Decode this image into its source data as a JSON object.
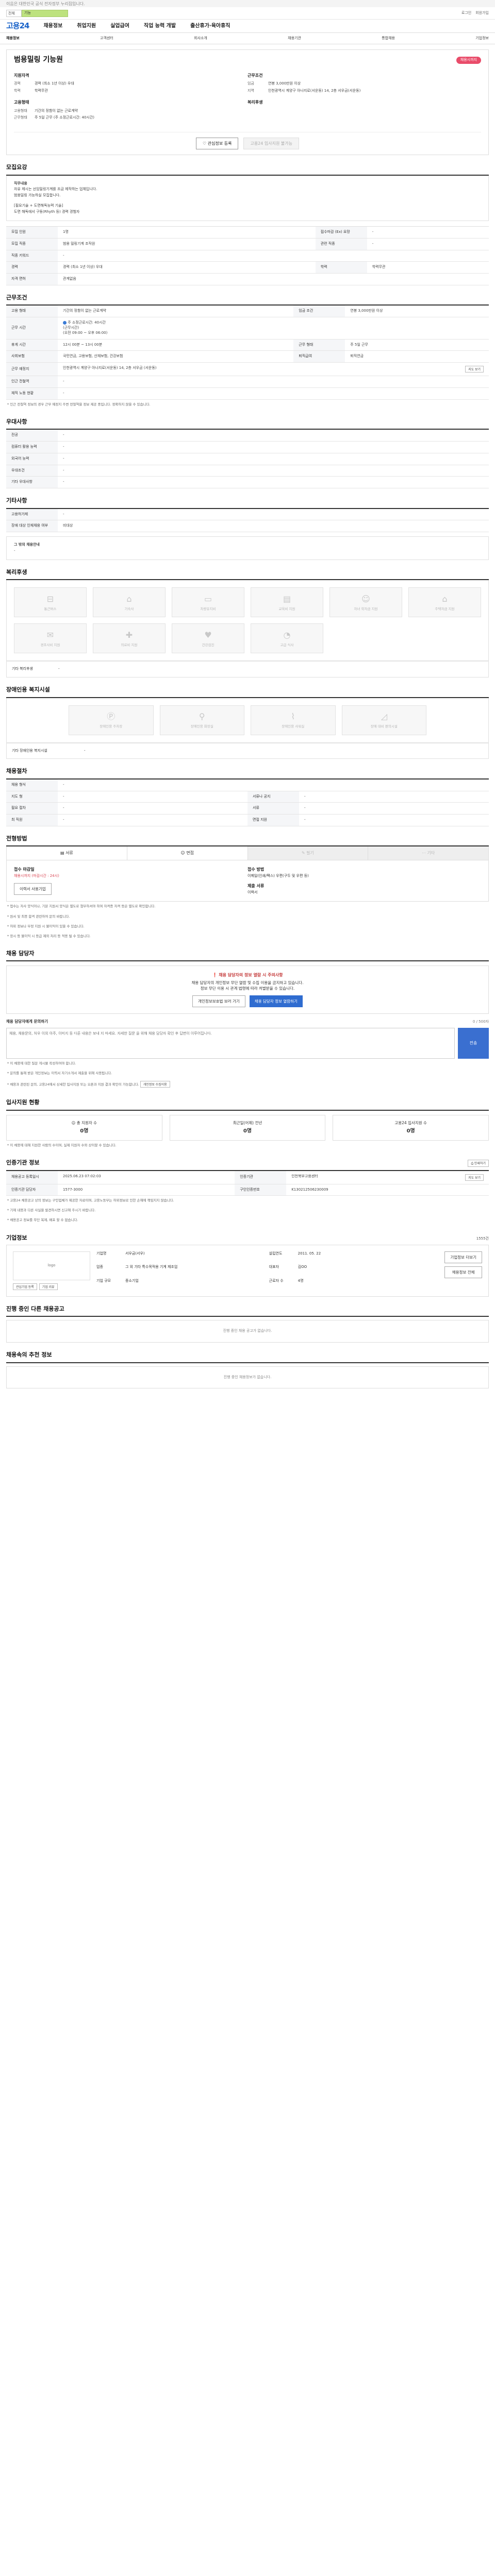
{
  "top_notice": "이음은 대한민국 공식 전자정부 누리집입니다.",
  "search": {
    "select": "전체",
    "value": "기능"
  },
  "util_links": [
    "로그인",
    "회원가입"
  ],
  "logo": "고용24",
  "gnb": [
    "채용정보",
    "취업지원",
    "실업급여",
    "직업 능력 개발",
    "출산휴가·육아휴직"
  ],
  "subnav": [
    "채용정보",
    "고객센터",
    "회사소개",
    "채용기관",
    "통합채용",
    "기업정보"
  ],
  "job": {
    "title": "범용밀링 기능원",
    "status_badge": "채용시까지",
    "left_h": "지원자격",
    "left": [
      [
        "경력",
        "경력 (최소 1년 이상) 우대"
      ],
      [
        "학력",
        "학력무관"
      ]
    ],
    "cond_h": "고용형태",
    "cond": [
      [
        "고용형태",
        "기간의 정함이 없는 근로계약"
      ],
      [
        "근무형태",
        "주 5일 근무 (주 소정근로시간: 40시간)"
      ]
    ],
    "right_h": "근무조건",
    "right": [
      [
        "임금",
        "연봉 3,000만원 이상"
      ],
      [
        "지역",
        "인천광역시 계양구 아나지로(서운동) 14, 2층 서우금(서운동)"
      ]
    ],
    "welfare_h": "복리후생",
    "btn_save": "관심정보 등록",
    "btn_apply": "고용24 입사지원 불가능"
  },
  "recruit": {
    "title": "모집요강",
    "body": [
      "직무내용",
      "자유 제시는 선임밀링기계를 조금 제작하는 업체입니다.",
      "범용밀링 가능하실 모집합니다.",
      "",
      "[필요기술 + 도면해독능력 기술]",
      "도면 해독에서 구동(Rhyth 등) 경력 경험자"
    ],
    "rows": [
      [
        "모집 인원",
        "1명",
        "접수마감 (Ex) 요망",
        "-"
      ],
      [
        "모집 직종",
        "범용 밀링기계 조작원",
        "관련 직종",
        "-"
      ],
      [
        "직종 키워드",
        "-",
        "",
        ""
      ],
      [
        "경력",
        "경력 (최소 1년 이상) 우대",
        "학력",
        "학력무관"
      ],
      [
        "자격 면허",
        "관계없음",
        "",
        ""
      ]
    ]
  },
  "work": {
    "title": "근무조건",
    "rows": [
      [
        "고용 형태",
        "기간의 정함이 없는 근로계약",
        "임금 조건",
        "연봉 3,000만원 이상"
      ]
    ],
    "hours_k": "근무 시간",
    "hours": [
      "주 소정근로시간: 40시간",
      "(근무시간)",
      "(오전 09:00 ~ 오후 06:00)",
      "(오전 09:00 ~ 오후 06:00)"
    ],
    "rows2": [
      [
        "휴게 시간",
        "12시 00분 ~ 13시 00분",
        "근무 형태",
        "주 5일 근무"
      ],
      [
        "사회보험",
        "국민연금, 고용보험, 산재보험, 건강보험",
        "퇴직급여",
        "퇴직연금"
      ]
    ],
    "addr_k": "근무 예정지",
    "addr_v": "인천광역시 계양구 아나지로(서운동) 14, 2층 서우금 (서운동)",
    "map_btn": "지도 보기",
    "rows3": [
      [
        "인근 전철역",
        "-"
      ],
      [
        "재직 노동 현황",
        "-"
      ]
    ],
    "note": "* 인근 전철역 정보의 경우 근무 예정지 주변 전철역을 정보 제공 중입니다. 정확하지 않을 수 있습니다."
  },
  "prefer": {
    "title": "우대사항",
    "rows": [
      [
        "전공",
        "-"
      ],
      [
        "컴퓨터 활용 능력",
        "-"
      ],
      [
        "외국어 능력",
        "-"
      ],
      [
        "우대조건",
        "-"
      ],
      [
        "기타 우대사항",
        "-"
      ]
    ]
  },
  "etc": {
    "title": "기타사항",
    "rows": [
      [
        "고용허가제",
        "-"
      ],
      [
        "장애 대상 인재채용 여부",
        "비대상"
      ]
    ],
    "extra": "그 밖의 채용안내",
    "extra_v": "-"
  },
  "welfare": {
    "title": "복리후생",
    "tiles": [
      "통근버스",
      "기숙사",
      "차량유지비",
      "교육비 지원",
      "자녀 학자금 지원",
      "주택자금 지원",
      "경조사비 지원",
      "의료비 지원",
      "건강검진",
      "고급 식사"
    ],
    "extra_k": "기타 복리후생",
    "extra_v": "-"
  },
  "barrier": {
    "title": "장애인용 복지시설",
    "tiles": [
      "장애인용 주차장",
      "장애인용 화장실",
      "장애인용 샤워실",
      "장애 대비 편의시설"
    ],
    "extra_k": "기타 장애인용 복지시설",
    "extra_v": "-"
  },
  "process": {
    "title": "채용절차",
    "rows": [
      [
        "채용 형식",
        "-",
        "",
        ""
      ],
      [
        "지도 형",
        "-",
        "서류나 공지",
        "-"
      ],
      [
        "필요 절차",
        "-",
        "서류",
        "-"
      ],
      [
        "최 직원",
        "-",
        "면접 지원",
        "-"
      ]
    ]
  },
  "apply": {
    "title": "전형방법",
    "tabs": [
      "서류",
      "면접",
      "필기",
      "기타"
    ],
    "left_h": "접수 마감일",
    "left_v": "채용시까지 (마감시간 : 24시)",
    "left_btn": "이력서 사용기업",
    "right_h": "접수 방법",
    "right_v": "이메일(인쇄/팩스) 우편(구두 및 우편 등)",
    "right_h2": "제출 서류",
    "right_v2": "이력서",
    "notes": [
      "* 접수는 자사 양식이나, 기본 지원서 양식은 별도로 첨부하셔야 하며 자격증 자격 등은 별도로 확인합니다.",
      "* 원서 및 최종 합격 관련하여 문의 바랍니다.",
      "* 허위 정보나 부정 지원 시 불이익이 있을 수 있습니다.",
      "* 장시 등 불이익 시 등급 제외 처리 등 적용 될 수 있습니다."
    ]
  },
  "manager": {
    "title": "채용 담당자",
    "alert_head": "채용 담당자의 정보 열람 시 주의사항",
    "alert_body": "채용 담당자의 개인정보 무단 열람 및 수집 이용을 금지하고 있습니다.",
    "alert_body2": "정보 무단 이용 시 관계 법령에 따라 처벌받을 수 있습니다.",
    "btn_view": "개인정보보호법 보러 가기",
    "btn_open": "채용 담당자 정보 열람하기",
    "qa_label": "채용 담당자에게 문의하기",
    "qa_count": "0 / 500자",
    "qa_placeholder": "채용, 채용문의, 처우 이외 아주, 이미지 등 다른 내용은 보내 지 마세요. 자세한 질문 을 위해 채용 담당자 확인 후 답변이 이루어집니다.",
    "qa_send": "전송",
    "notes": [
      "* 이 채용에 대한 질문 게시물 작성하여야 합니다.",
      "* 문의를 통해 받은 개인정보는 이력서 자기소개서 제출을 위해 사용됩니다.",
      "* 채용과 관련된 문의, 고용24에서 상세한 입사지원 또는 오픈과 지원 결과 확인이 가능합니다."
    ],
    "notes_btn": "개인정보 수집이용"
  },
  "stats": {
    "title": "입사지원 현황",
    "items": [
      [
        "총 지원자 수",
        "0명"
      ],
      [
        "최근일(어제) 전년",
        "0명"
      ],
      [
        "고용24 입사지원 수",
        "0명"
      ]
    ],
    "note": "* 이 채용에 대해 지원한 사람의 수이며, 실제 지원자 수와 상이할 수 있습니다."
  },
  "info": {
    "title": "인증기관 정보",
    "print_btn": "인쇄하기",
    "rows": [
      [
        "채용공고 등록일시",
        "2025.06.23 07:02:03",
        "인증기관",
        "인천북부고용센터",
        "지도 보기"
      ],
      [
        "인증기관 담당자",
        "1577-3000",
        "구인인증번호",
        "K130212506230009"
      ]
    ],
    "notes": [
      "* 고용24 채용공고 상의 정보는 구인업체가 제공한 자료이며, 고용노동부는 허위정보로 인한 손해에 책임지지 않습니다.",
      "* 기재 내용과 다른 사실을 발견하시면 신고해 주시기 바랍니다.",
      "* 채용공고 정보를 무단 복제, 배포 할 수 없습니다."
    ]
  },
  "company": {
    "title": "기업정보",
    "count": "1555건",
    "logo_text": "logo",
    "k1": "기업명",
    "v1": "서우금(서우)",
    "k2": "업종",
    "v2": "그 외 기타 특수목적용 기계 제조업",
    "k3": "설립연도",
    "v3": "2011. 05. 22",
    "k4": "대표자",
    "v4": "김OO",
    "k5": "근로자 수",
    "v5": "4명",
    "k6": "기업 규모",
    "v6": "중소기업",
    "btn_more": "기업정보 더보기",
    "btn_all": "채용정보 전체",
    "left_btns": [
      "관심기업 등록",
      "기업 리뷰"
    ]
  },
  "other_jobs": {
    "title": "진행 중인 다른 채용공고",
    "empty": "진행 중인 채용 공고가 없습니다."
  },
  "recommend": {
    "title": "채용속의 추천 정보",
    "empty": "진행 중인 채용정보가 없습니다."
  }
}
